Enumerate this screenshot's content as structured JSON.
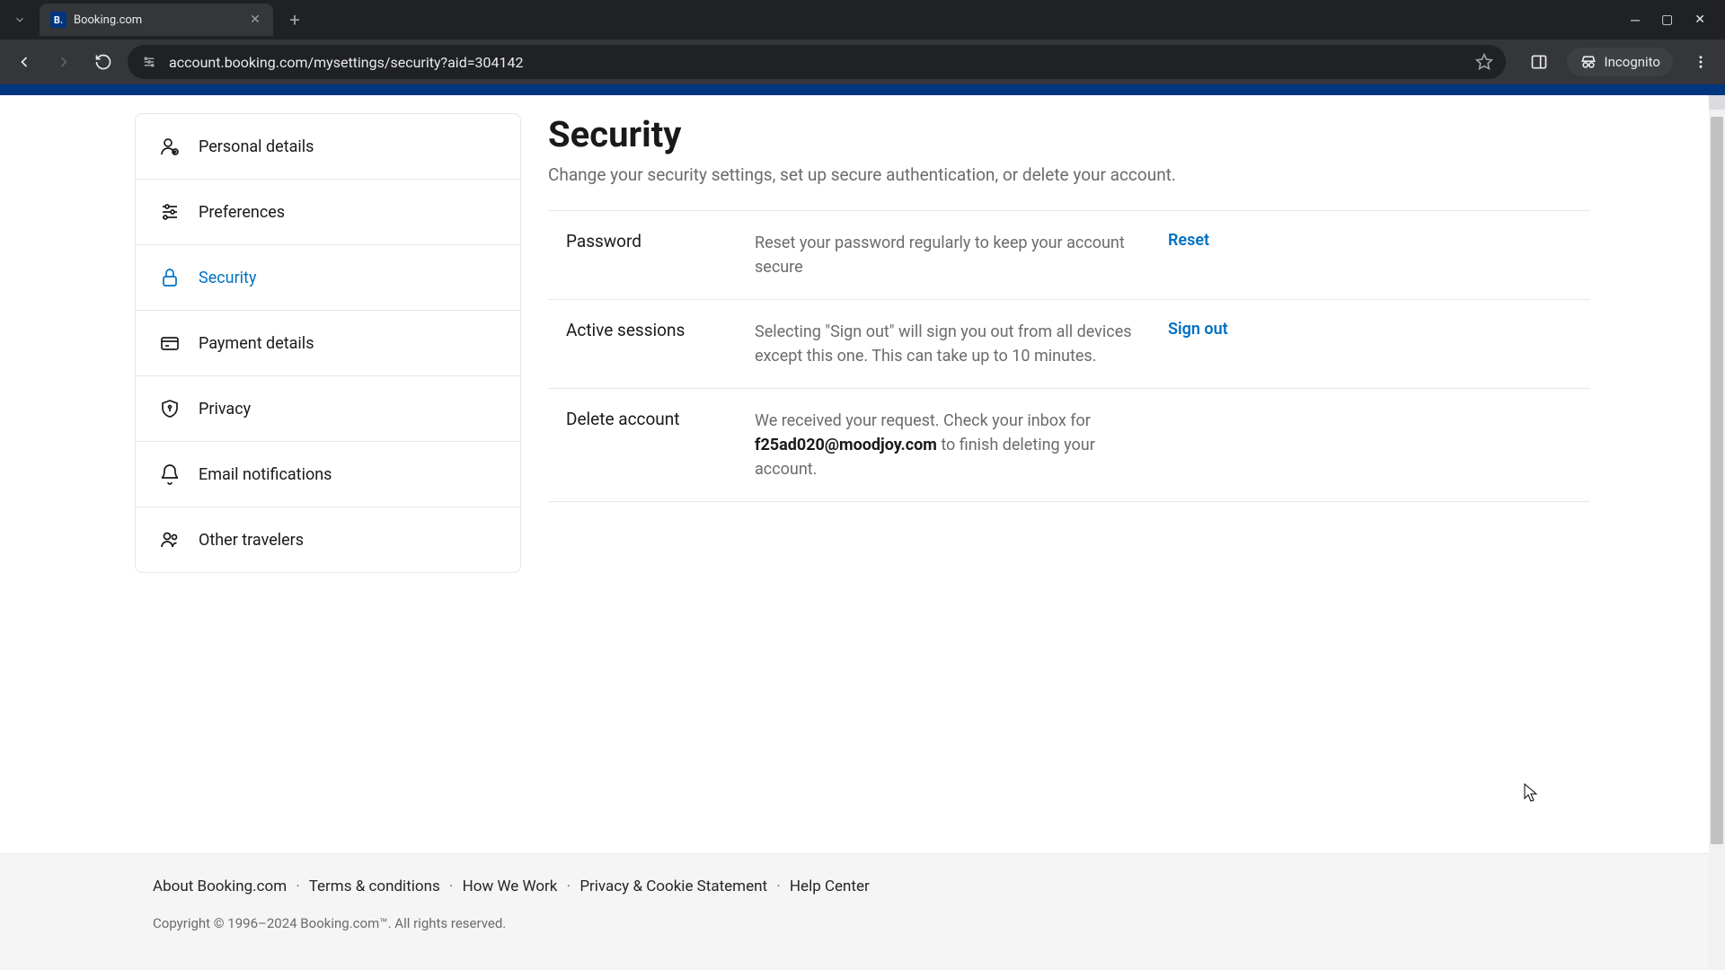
{
  "browser": {
    "tab_title": "Booking.com",
    "url": "account.booking.com/mysettings/security?aid=304142",
    "incognito_label": "Incognito"
  },
  "sidebar": {
    "items": [
      {
        "label": "Personal details"
      },
      {
        "label": "Preferences"
      },
      {
        "label": "Security"
      },
      {
        "label": "Payment details"
      },
      {
        "label": "Privacy"
      },
      {
        "label": "Email notifications"
      },
      {
        "label": "Other travelers"
      }
    ]
  },
  "main": {
    "title": "Security",
    "subtitle": "Change your security settings, set up secure authentication, or delete your account.",
    "rows": {
      "password": {
        "label": "Password",
        "desc": "Reset your password regularly to keep your account secure",
        "action": "Reset"
      },
      "sessions": {
        "label": "Active sessions",
        "desc": "Selecting \"Sign out\" will sign you out from all devices except this one. This can take up to 10 minutes.",
        "action": "Sign out"
      },
      "delete": {
        "label": "Delete account",
        "desc_pre": "We received your request. Check your inbox for ",
        "email": "f25ad020@moodjoy.com",
        "desc_post": " to finish deleting your account."
      }
    }
  },
  "footer": {
    "links": {
      "about": "About Booking.com",
      "terms": "Terms & conditions",
      "how": "How We Work",
      "privacy": "Privacy & Cookie Statement",
      "help": "Help Center"
    },
    "copyright": "Copyright © 1996–2024 Booking.com™. All rights reserved."
  }
}
